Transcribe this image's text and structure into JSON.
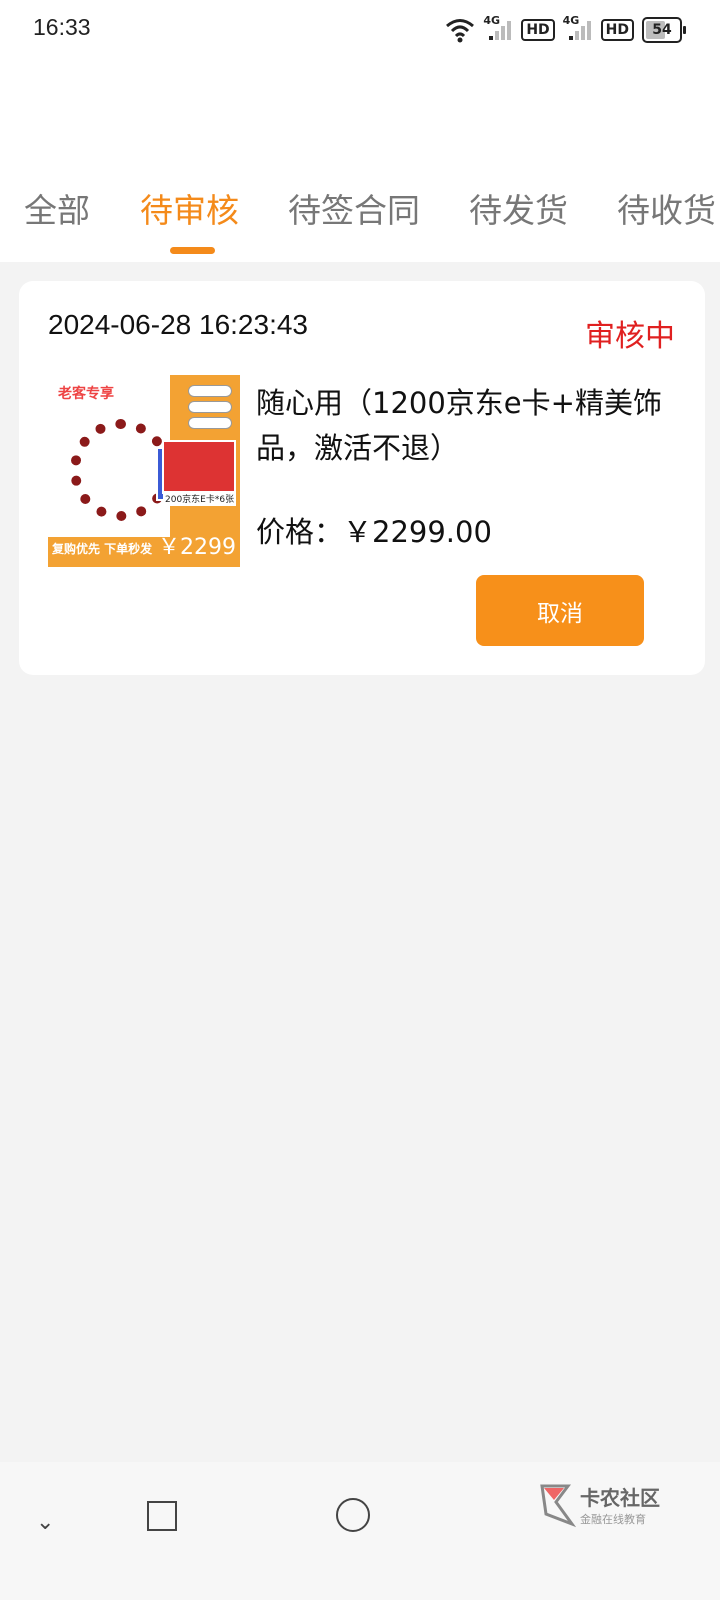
{
  "status_bar": {
    "time": "16:33",
    "net1": "4G",
    "hd1": "HD",
    "net2": "4G",
    "hd2": "HD",
    "battery": "54"
  },
  "tabs": [
    {
      "label": "全部",
      "active": false
    },
    {
      "label": "待审核",
      "active": true
    },
    {
      "label": "待签合同",
      "active": false
    },
    {
      "label": "待发货",
      "active": false
    },
    {
      "label": "待收货",
      "active": false
    }
  ],
  "order": {
    "time": "2024-06-28 16:23:43",
    "status": "审核中",
    "name": "随心用（1200京东e卡+精美饰品，激活不退）",
    "price": "价格：￥2299.00",
    "cancel_label": "取消",
    "status_color": "#e02020"
  },
  "thumbnail": {
    "tag": "老客专享",
    "card_text": "200京东E卡*6张",
    "bottom_text": "复购优先  下单秒发",
    "price": "￥2299"
  },
  "watermark": {
    "title": "卡农社区",
    "subtitle": "金融在线教育"
  },
  "colors": {
    "accent": "#f48a1a",
    "status_red": "#e02020",
    "background": "#f3f3f3"
  }
}
